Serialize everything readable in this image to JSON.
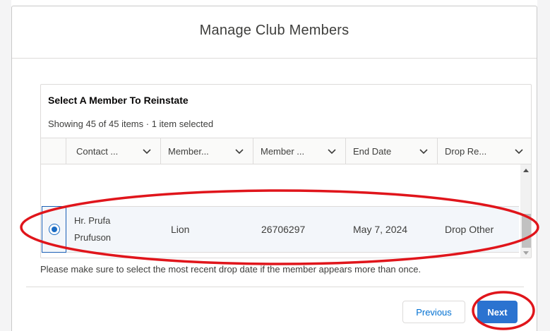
{
  "modal": {
    "title": "Manage Club Members"
  },
  "table": {
    "title": "Select A Member To Reinstate",
    "status": "Showing 45 of 45 items · 1 item selected",
    "columns": [
      {
        "label": "Contact ..."
      },
      {
        "label": "Member..."
      },
      {
        "label": "Member ..."
      },
      {
        "label": "End Date"
      },
      {
        "label": "Drop Re..."
      }
    ],
    "selected_row": {
      "contact_line1": "Hr. Prufa",
      "contact_line2": "Prufuson",
      "member_type": "Lion",
      "member_number": "26706297",
      "end_date": "May 7, 2024",
      "drop_reason": "Drop Other",
      "selected": true
    }
  },
  "note": "Please make sure to select the most recent drop date if the member appears more than once.",
  "footer": {
    "previous_label": "Previous",
    "next_label": "Next"
  },
  "colors": {
    "accent": "#2b73d0",
    "annotation": "#e0151b",
    "selected_row_bg": "#f3f6fa"
  }
}
